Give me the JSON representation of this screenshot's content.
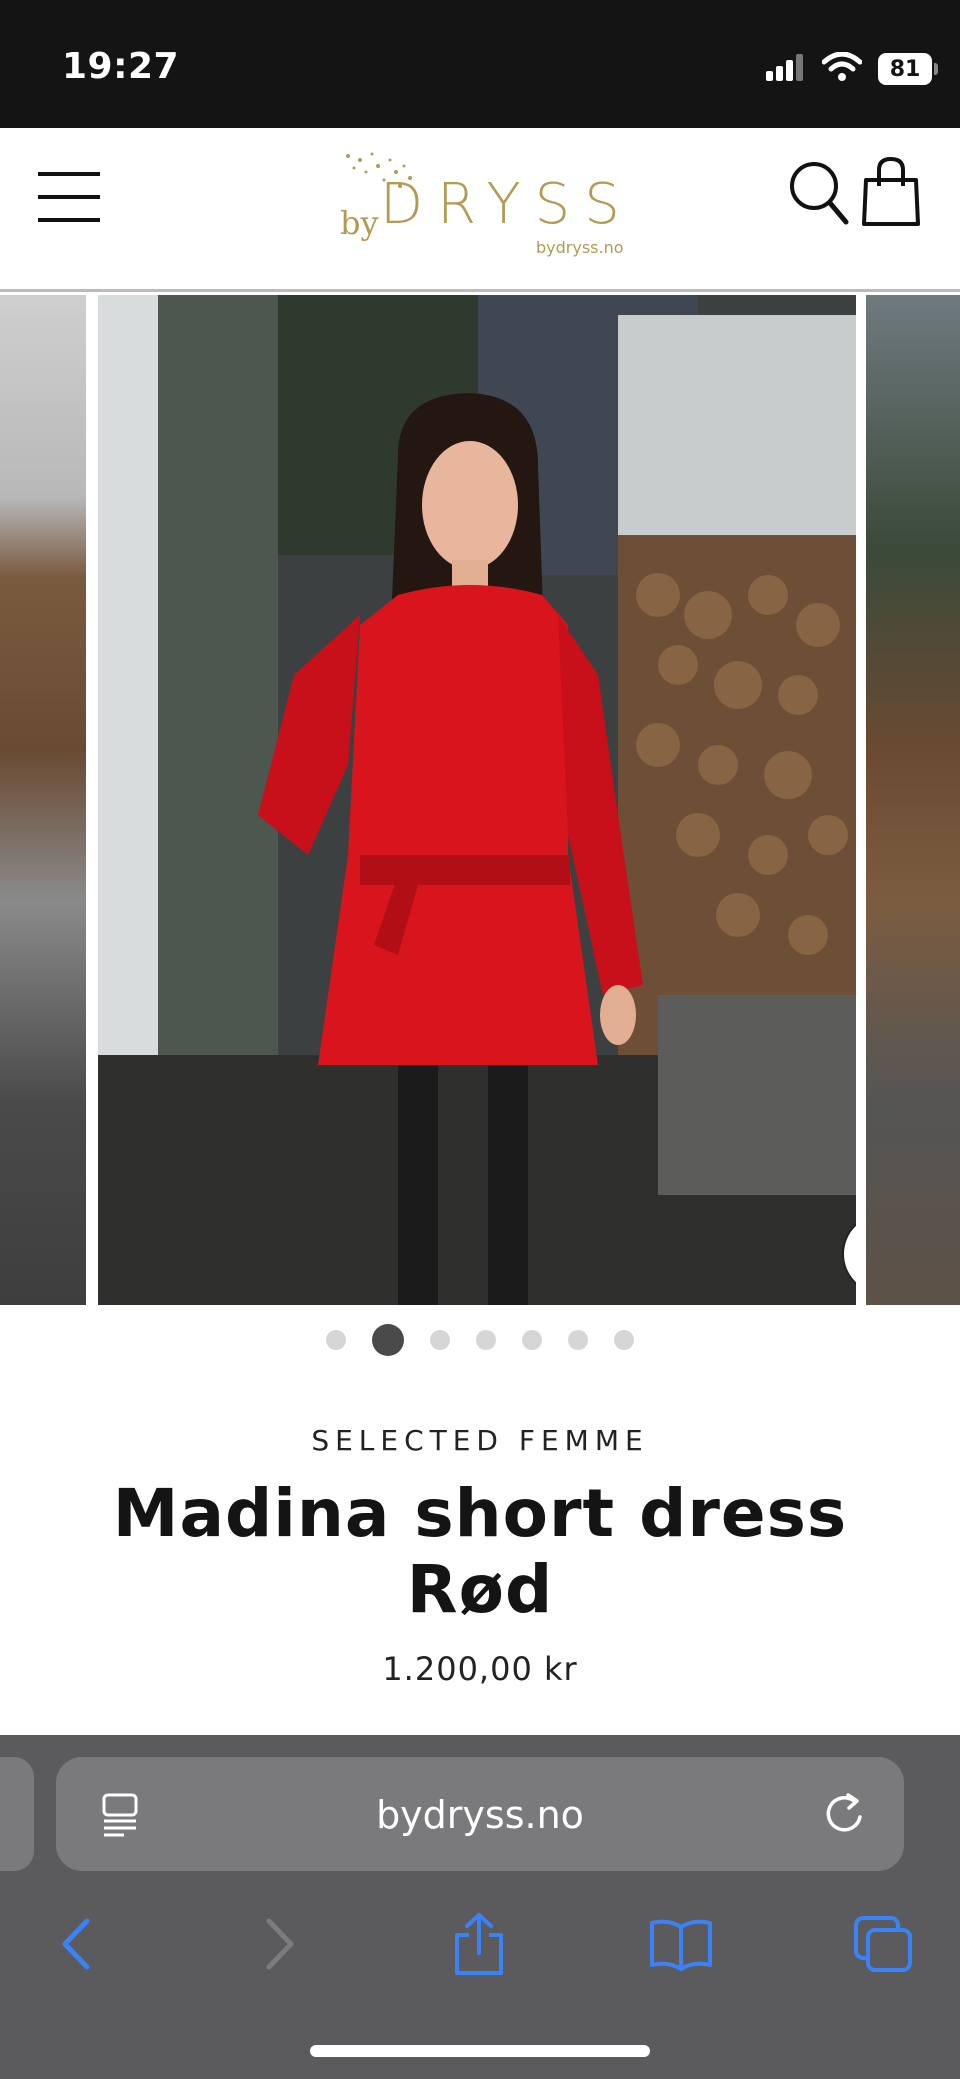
{
  "status_bar": {
    "time": "19:27",
    "battery": "81",
    "icons": [
      "signal-icon",
      "wifi-icon",
      "battery-icon"
    ]
  },
  "header": {
    "logo": {
      "by": "by",
      "name": "DRYSS",
      "domain": "bydryss.no"
    },
    "icons": [
      "menu-icon",
      "search-icon",
      "cart-icon"
    ],
    "accent_color": "#b39a55"
  },
  "gallery": {
    "slide_count": 7,
    "active_index": 1,
    "zoom_icon": "zoom-icon"
  },
  "product": {
    "brand": "SELECTED FEMME",
    "title_line1": "Madina short dress",
    "title_line2": "Rød",
    "price": "1.200,00 kr",
    "dress_color": "#d8141c"
  },
  "browser": {
    "url": "bydryss.no",
    "toolbar_icons": [
      "back-icon",
      "forward-icon",
      "share-icon",
      "bookmarks-icon",
      "tabs-icon"
    ],
    "accent_color": "#3b82f6"
  }
}
